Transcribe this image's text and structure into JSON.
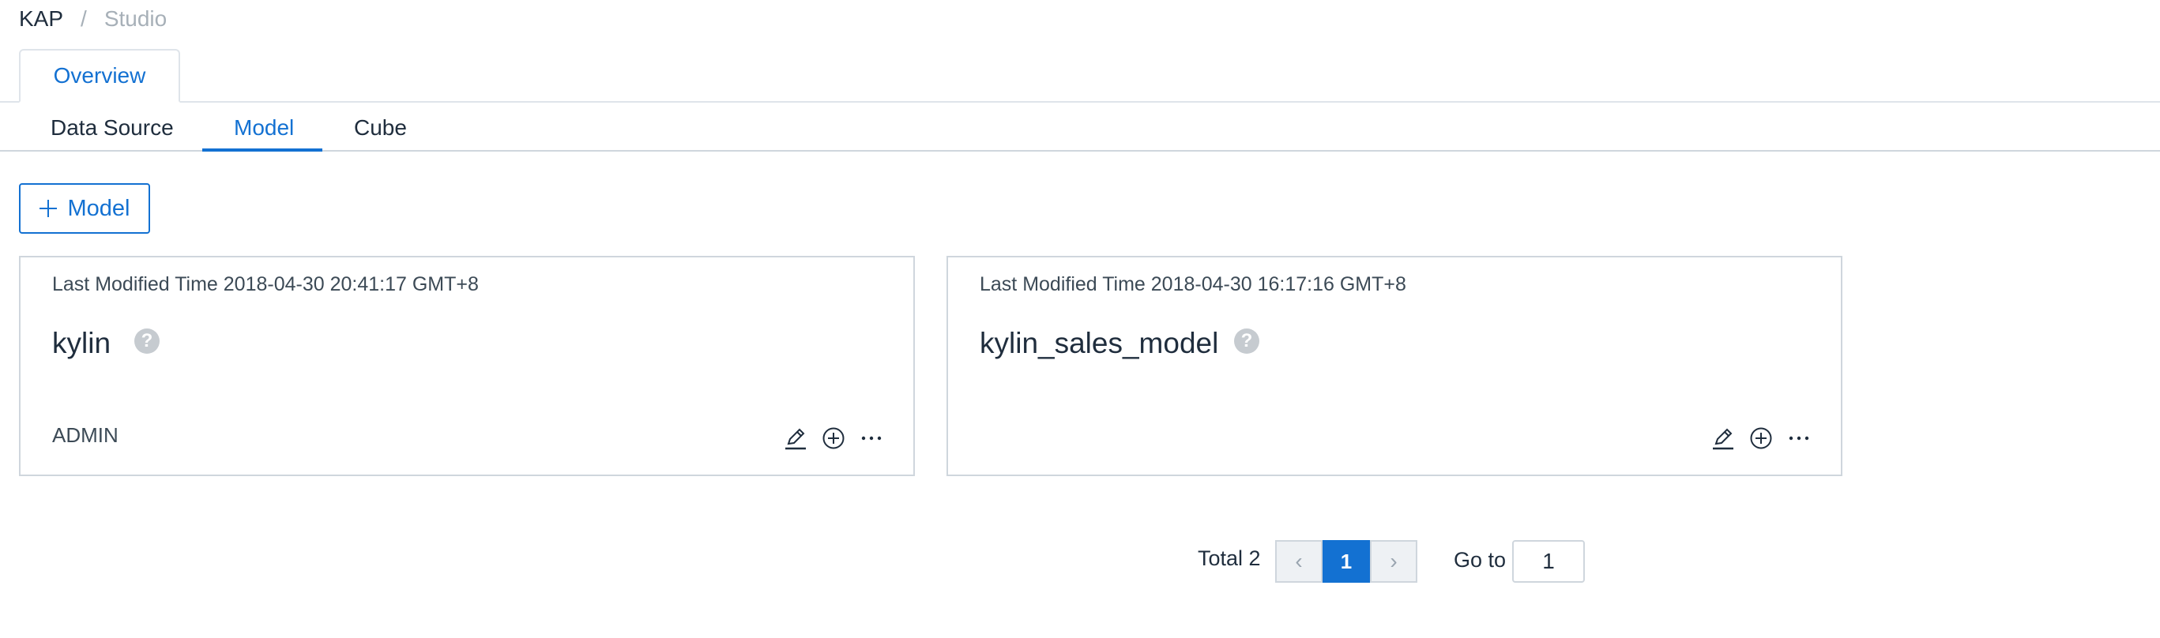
{
  "breadcrumb": {
    "root": "KAP",
    "separator": "/",
    "current": "Studio"
  },
  "top_tabs": [
    {
      "label": "Overview",
      "active": true
    }
  ],
  "sub_tabs": [
    {
      "label": "Data Source",
      "active": false
    },
    {
      "label": "Model",
      "active": true
    },
    {
      "label": "Cube",
      "active": false
    }
  ],
  "add_button": {
    "label": "Model"
  },
  "models": [
    {
      "modified": "Last Modified Time 2018-04-30 20:41:17 GMT+8",
      "name": "kylin",
      "owner": "ADMIN",
      "help": "?"
    },
    {
      "modified": "Last Modified Time 2018-04-30 16:17:16 GMT+8",
      "name": "kylin_sales_model",
      "owner": "",
      "help": "?"
    }
  ],
  "pagination": {
    "total_label": "Total 2",
    "prev": "‹",
    "current_page": "1",
    "next": "›",
    "goto_label": "Go to",
    "goto_value": "1"
  },
  "colors": {
    "accent": "#1371d2",
    "border": "#cfd6dd",
    "help_icon": "#c6cbd0"
  },
  "icons": [
    "plus-icon",
    "question-icon",
    "edit-pencil-icon",
    "add-circle-icon",
    "more-ellipsis-icon",
    "chevron-left-icon",
    "chevron-right-icon"
  ]
}
